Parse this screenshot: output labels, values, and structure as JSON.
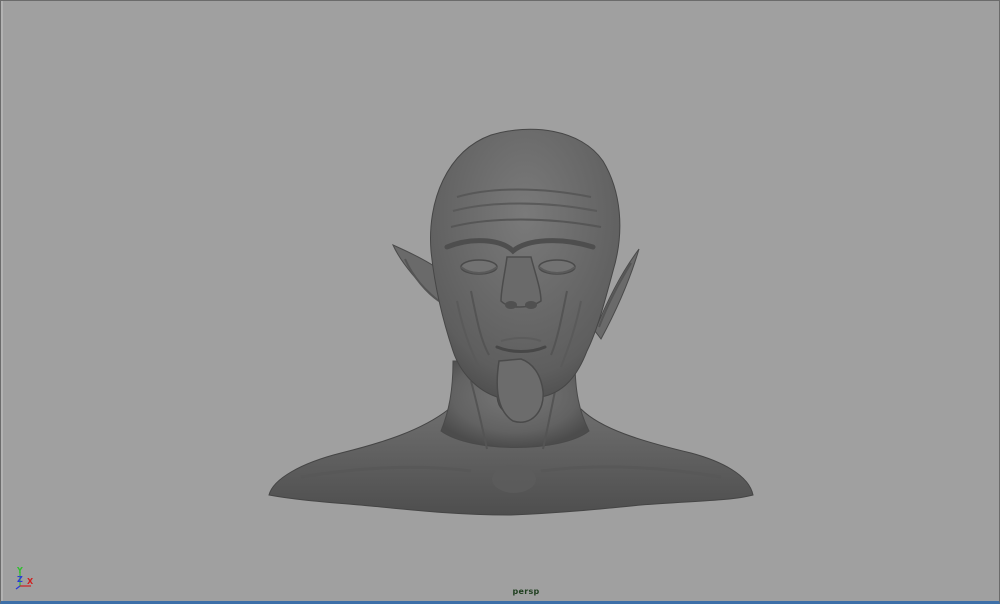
{
  "viewport": {
    "camera_name": "persp",
    "background_color": "#a0a0a0",
    "model_color": "#6a6a6a",
    "active_border_color": "#3d6fa8"
  },
  "axis_gizmo": {
    "y_label": "Y",
    "z_label": "Z",
    "x_label": "X",
    "y_color": "#2fbf2f",
    "z_color": "#2b3bd6",
    "x_color": "#d02020"
  }
}
